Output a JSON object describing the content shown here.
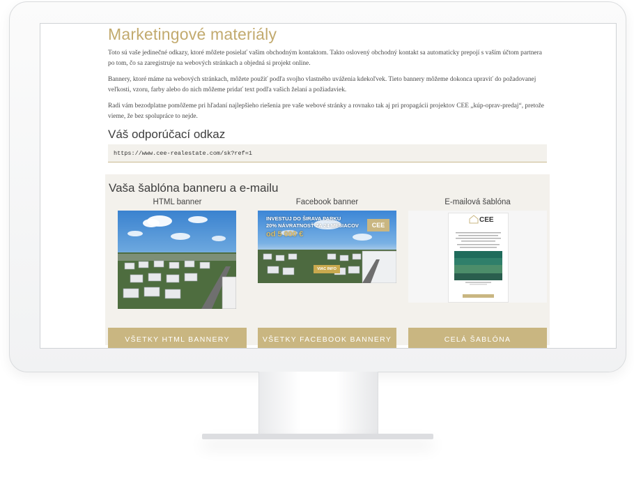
{
  "page": {
    "title": "Marketingové materiály",
    "paragraphs": [
      "Toto sú vaše jedinečné odkazy, ktoré môžete posielať vašim obchodným kontaktom. Takto oslovený obchodný kontakt sa automaticky prepojí s vaším účtom partnera po tom, čo sa zaregistruje na webových stránkach a objedná si projekt online.",
      "Bannery, ktoré máme na webových stránkach, môžete použiť podľa svojho vlastného uváženia kdekoľvek. Tieto bannery môžeme dokonca upraviť do požadovanej veľkosti, vzoru, farby alebo do nich môžeme pridať text podľa vašich želaní a požiadaviek.",
      "Radi vám bezodplatne pomôžeme pri hľadaní najlepšieho riešenia pre vaše webové stránky a rovnako tak aj pri propagácii projektov CEE „kúp-oprav-predaj“, pretože vieme, že bez spolupráce to nejde."
    ],
    "referral_title": "Váš odporúčací odkaz",
    "referral_link": "https://www.cee-realestate.com/sk?ref=1"
  },
  "templates": {
    "title": "Vaša šablóna banneru a e-mailu",
    "columns": [
      {
        "label": "HTML banner",
        "button": "VŠETKY HTML BANNERY"
      },
      {
        "label": "Facebook banner",
        "button": "VŠETKY FACEBOOK BANNERY"
      },
      {
        "label": "E-mailová šablóna",
        "button": "CELÁ ŠABLÓNA"
      }
    ],
    "fb_banner": {
      "line1": "INVESTUJ DO  ŠIRAVA PARKU",
      "line2": "20% NÁVRATNOSŤ ZA 24 MESIACOV",
      "line3": "od 5 000 €",
      "logo": "CEE",
      "cta": "VIAC INFO"
    },
    "email_card": {
      "logo": "CEE"
    }
  },
  "colors": {
    "accent": "#c9b681",
    "title": "#c2aa6e",
    "panel": "#f3f1ec"
  }
}
